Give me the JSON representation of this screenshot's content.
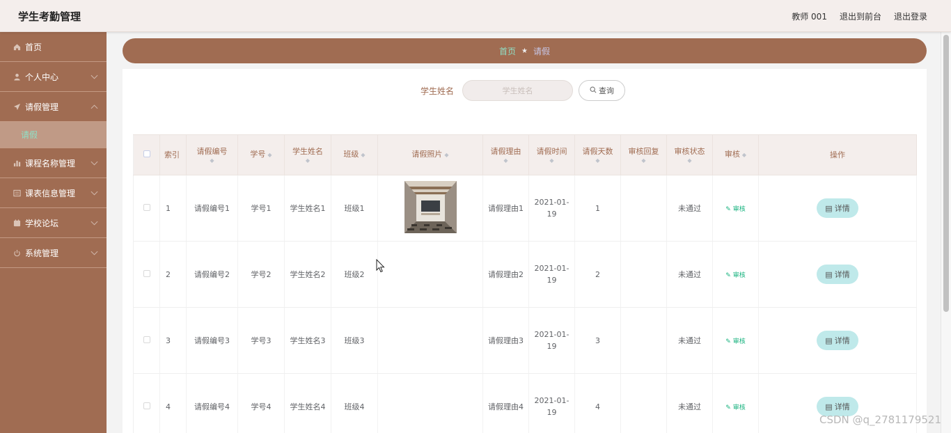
{
  "header": {
    "title": "学生考勤管理",
    "user": "教师 001",
    "to_front": "退出到前台",
    "logout": "退出登录"
  },
  "sidebar": {
    "items": [
      {
        "label": "首页",
        "icon": "home-icon"
      },
      {
        "label": "个人中心",
        "icon": "user-icon"
      },
      {
        "label": "请假管理",
        "icon": "send-icon"
      },
      {
        "label": "课程名称管理",
        "icon": "chart-icon"
      },
      {
        "label": "课表信息管理",
        "icon": "list-icon"
      },
      {
        "label": "学校论坛",
        "icon": "forum-icon"
      },
      {
        "label": "系统管理",
        "icon": "power-icon"
      }
    ],
    "sub_item": "请假"
  },
  "breadcrumb": {
    "home": "首页",
    "current": "请假"
  },
  "search": {
    "label": "学生姓名",
    "placeholder": "学生姓名",
    "button": "查询"
  },
  "table": {
    "headers": {
      "index": "索引",
      "leave_no": "请假编号",
      "student_no": "学号",
      "student_name": "学生姓名",
      "class": "班级",
      "photo": "请假照片",
      "reason": "请假理由",
      "time": "请假时间",
      "days": "请假天数",
      "reply": "审核回复",
      "status": "审核状态",
      "audit": "审核",
      "ops": "操作"
    },
    "rows": [
      {
        "index": "1",
        "leave_no": "请假编号1",
        "student_no": "学号1",
        "student_name": "学生姓名1",
        "class": "班级1",
        "reason": "请假理由1",
        "date_a": "2021-01-",
        "date_b": "19",
        "days": "1",
        "reply": "",
        "status": "未通过",
        "audit": "审核",
        "detail": "详情"
      },
      {
        "index": "2",
        "leave_no": "请假编号2",
        "student_no": "学号2",
        "student_name": "学生姓名2",
        "class": "班级2",
        "reason": "请假理由2",
        "date_a": "2021-01-",
        "date_b": "19",
        "days": "2",
        "reply": "",
        "status": "未通过",
        "audit": "审核",
        "detail": "详情"
      },
      {
        "index": "3",
        "leave_no": "请假编号3",
        "student_no": "学号3",
        "student_name": "学生姓名3",
        "class": "班级3",
        "reason": "请假理由3",
        "date_a": "2021-01-",
        "date_b": "19",
        "days": "3",
        "reply": "",
        "status": "未通过",
        "audit": "审核",
        "detail": "详情"
      },
      {
        "index": "4",
        "leave_no": "请假编号4",
        "student_no": "学号4",
        "student_name": "学生姓名4",
        "class": "班级4",
        "reason": "请假理由4",
        "date_a": "2021-01-",
        "date_b": "19",
        "days": "4",
        "reply": "",
        "status": "未通过",
        "audit": "审核",
        "detail": "详情"
      }
    ]
  },
  "watermark": "CSDN @q_2781179521",
  "colors": {
    "brand": "#a06c52",
    "accent": "#8fe0c6",
    "audit": "#19b37f",
    "detail_bg": "#bfe9ea"
  }
}
